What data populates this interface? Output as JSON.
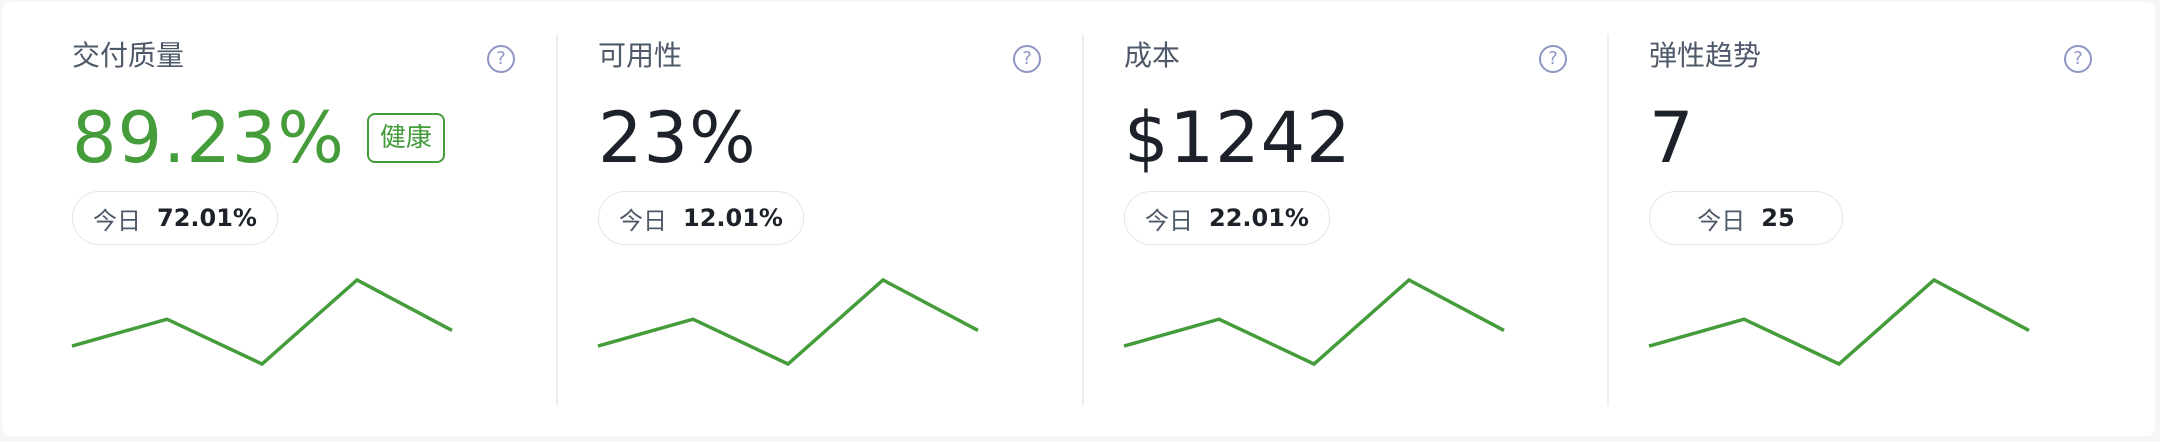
{
  "accent_color": "#459c3a",
  "metrics": [
    {
      "title": "交付质量",
      "value": "89.23%",
      "badge": "健康",
      "today_label": "今日",
      "today_value": "72.01%",
      "help_icon": "question-circle-icon",
      "sparkline": [
        0.41,
        0.65,
        0.25,
        1.0,
        0.55
      ]
    },
    {
      "title": "可用性",
      "value": "23%",
      "today_label": "今日",
      "today_value": "12.01%",
      "help_icon": "question-circle-icon",
      "sparkline": [
        0.41,
        0.65,
        0.25,
        1.0,
        0.55
      ]
    },
    {
      "title": "成本",
      "value": "$1242",
      "today_label": "今日",
      "today_value": "22.01%",
      "help_icon": "question-circle-icon",
      "sparkline": [
        0.41,
        0.65,
        0.25,
        1.0,
        0.55
      ]
    },
    {
      "title": "弹性趋势",
      "value": "7",
      "today_label": "今日",
      "today_value": "25",
      "help_icon": "question-circle-icon",
      "sparkline": [
        0.41,
        0.65,
        0.25,
        1.0,
        0.55
      ]
    }
  ]
}
